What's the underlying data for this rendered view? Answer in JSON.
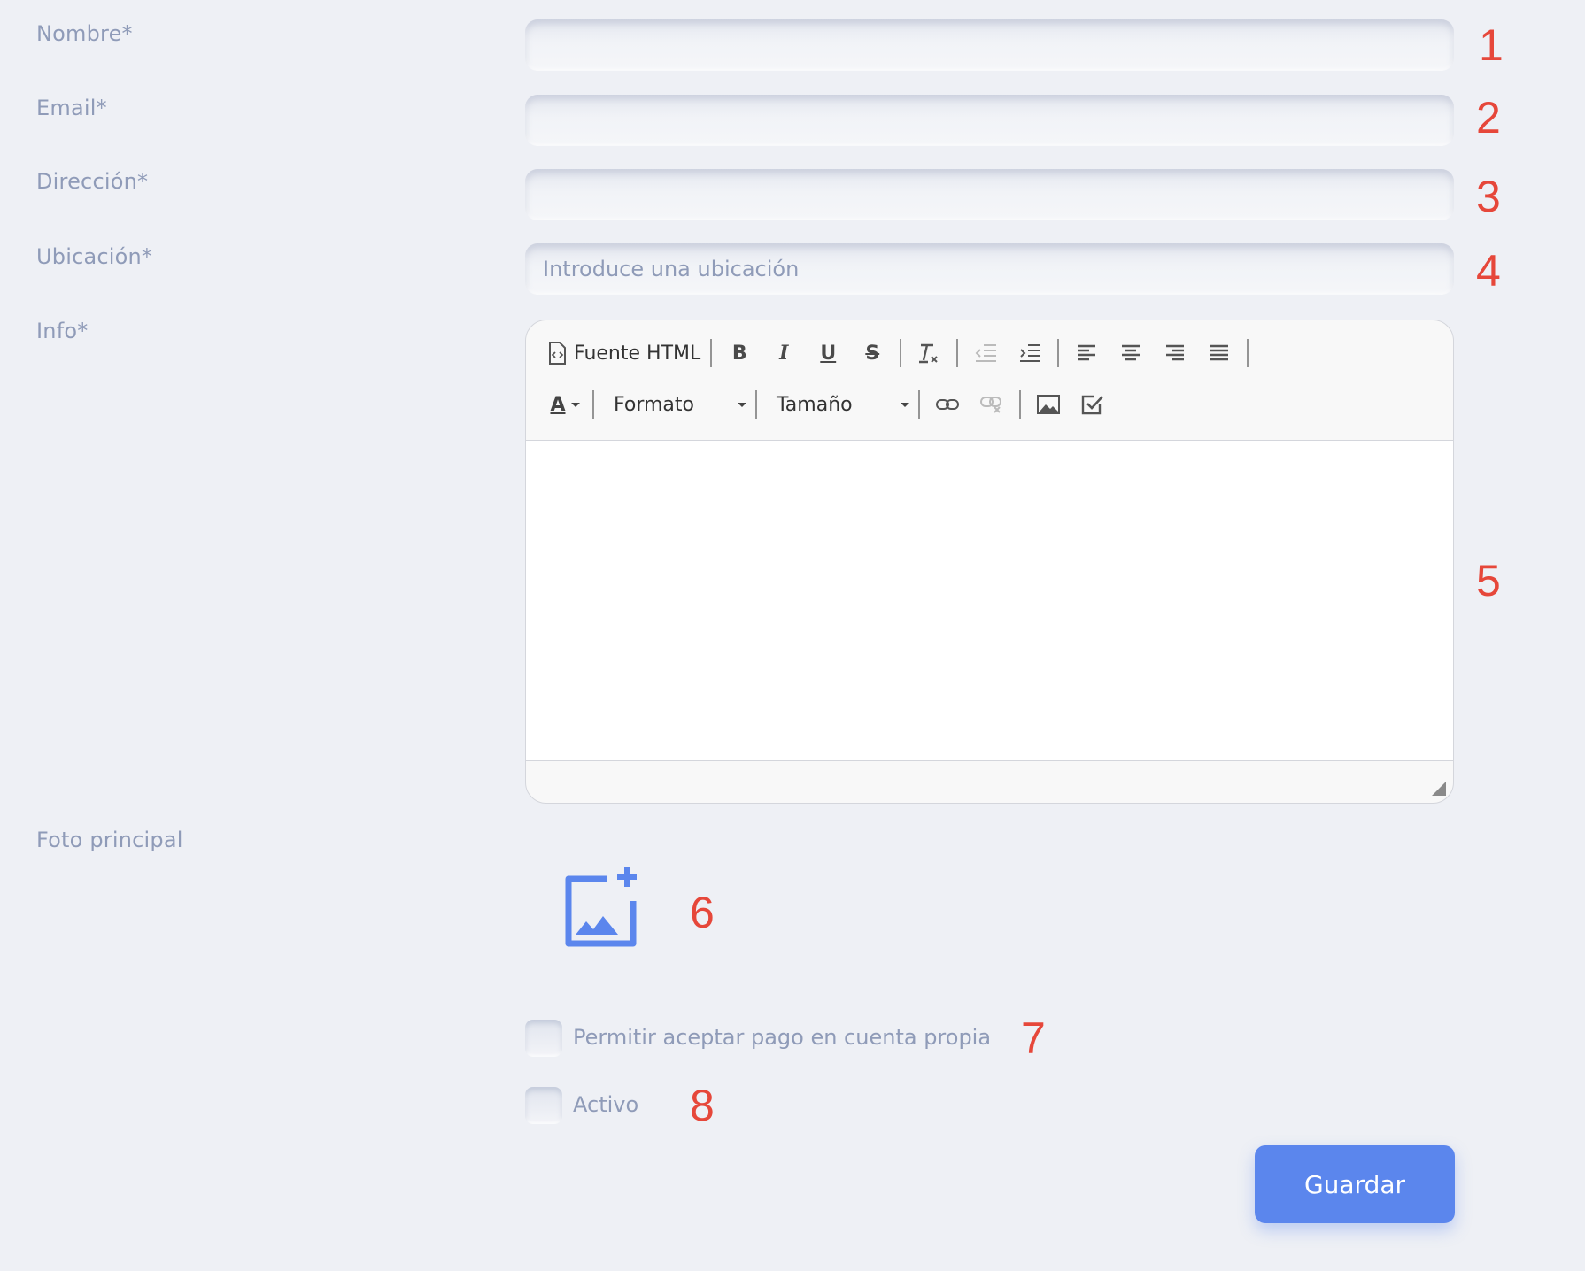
{
  "form": {
    "fields": [
      {
        "label": "Nombre*",
        "value": "",
        "placeholder": "",
        "annotation": "1"
      },
      {
        "label": "Email*",
        "value": "",
        "placeholder": "",
        "annotation": "2"
      },
      {
        "label": "Dirección*",
        "value": "",
        "placeholder": "",
        "annotation": "3"
      },
      {
        "label": "Ubicación*",
        "value": "",
        "placeholder": "Introduce una ubicación",
        "annotation": "4"
      }
    ],
    "info": {
      "label": "Info*",
      "annotation": "5",
      "toolbar": {
        "source_label": "Fuente HTML",
        "format_label": "Formato",
        "size_label": "Tamaño"
      }
    },
    "photo": {
      "label": "Foto principal",
      "annotation": "6"
    },
    "checkboxes": [
      {
        "label": "Permitir aceptar pago en cuenta propia",
        "checked": false,
        "annotation": "7"
      },
      {
        "label": "Activo",
        "checked": false,
        "annotation": "8"
      }
    ],
    "save_label": "Guardar"
  },
  "colors": {
    "background": "#eef0f5",
    "label": "#8f9bb8",
    "accent": "#5b86ed",
    "annotation": "#e6473a"
  },
  "icons": [
    "source-code-icon",
    "bold-icon",
    "italic-icon",
    "underline-icon",
    "strikethrough-icon",
    "remove-format-icon",
    "outdent-icon",
    "indent-icon",
    "align-left-icon",
    "align-center-icon",
    "align-right-icon",
    "align-justify-icon",
    "text-color-icon",
    "link-icon",
    "unlink-icon",
    "image-icon",
    "checkbox-icon",
    "add-photo-icon"
  ]
}
